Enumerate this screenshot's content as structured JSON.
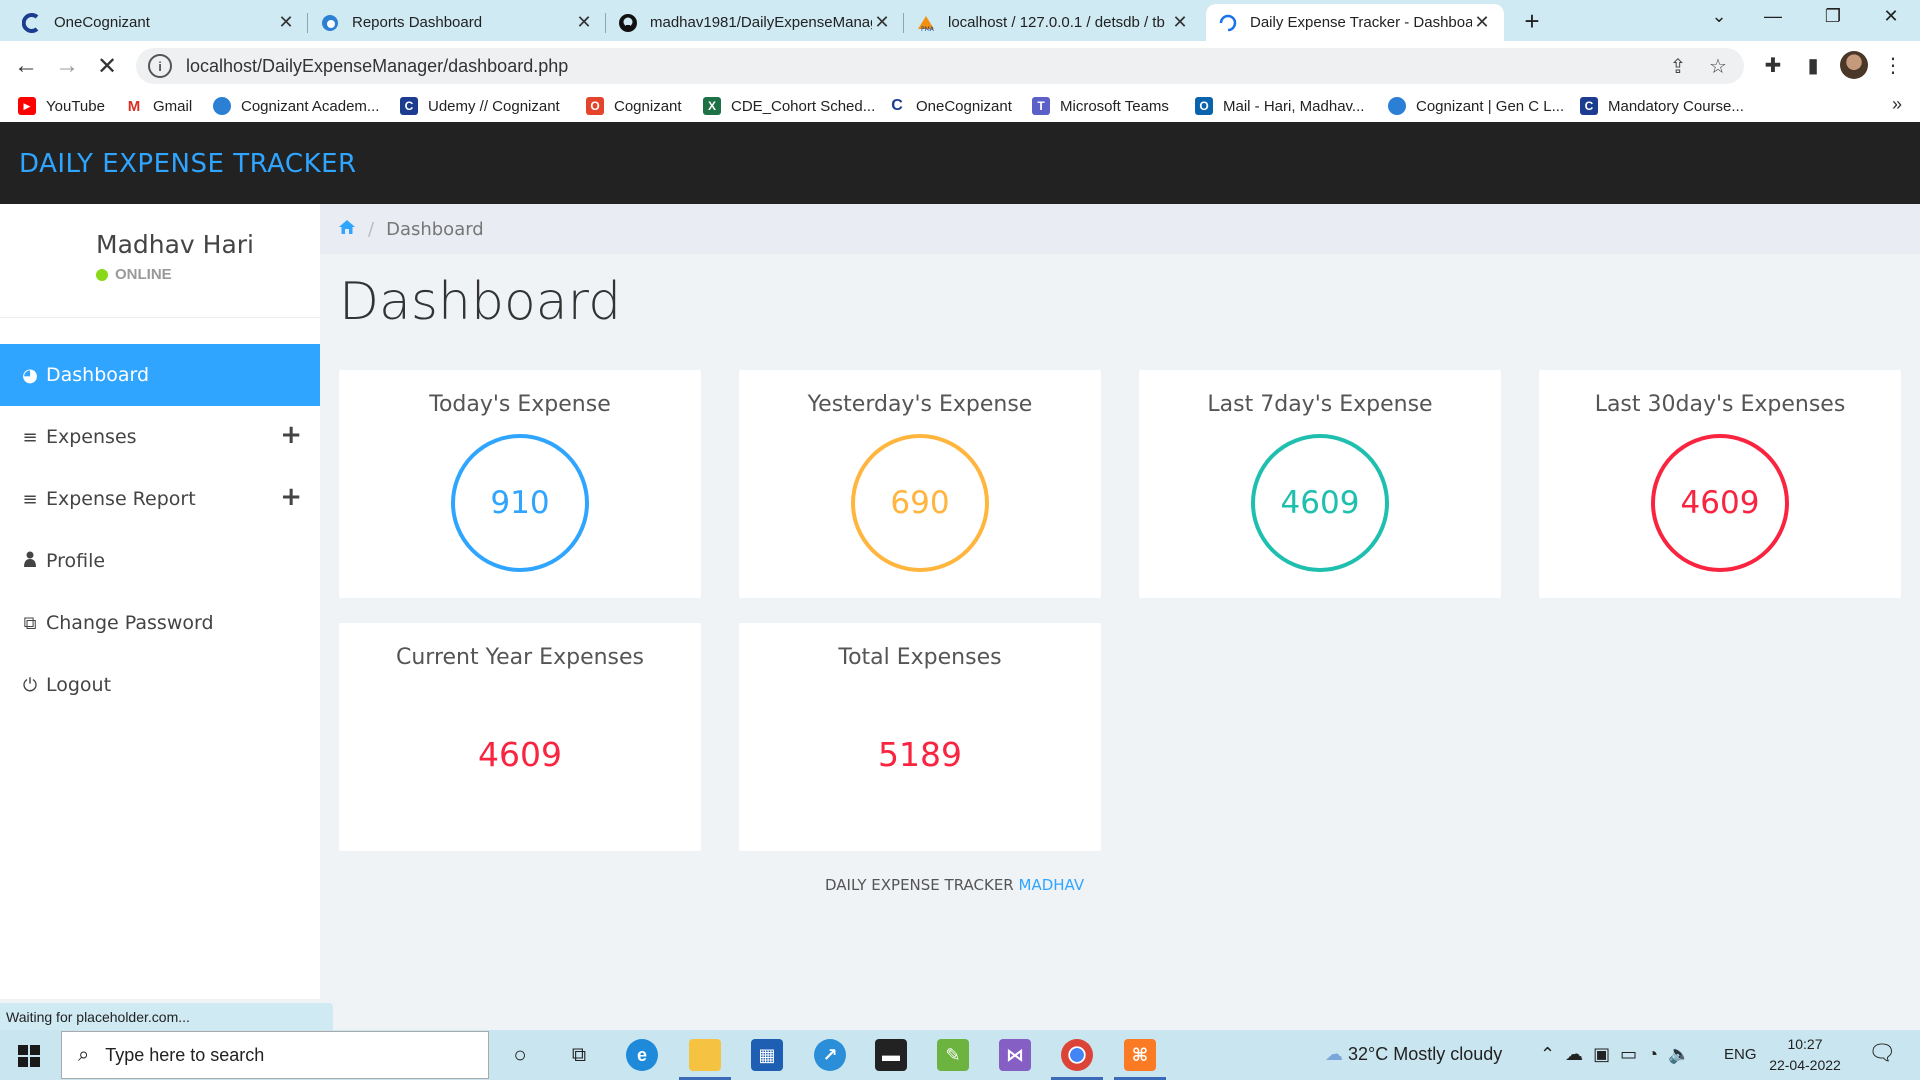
{
  "browser": {
    "tabs": [
      {
        "title": "OneCognizant"
      },
      {
        "title": "Reports Dashboard"
      },
      {
        "title": "madhav1981/DailyExpenseManag"
      },
      {
        "title": "localhost / 127.0.0.1 / detsdb / tb"
      },
      {
        "title": "Daily Expense Tracker - Dashboar"
      }
    ],
    "url": "localhost/DailyExpenseManager/dashboard.php",
    "bookmarks": [
      {
        "label": "YouTube"
      },
      {
        "label": "Gmail"
      },
      {
        "label": "Cognizant Academ..."
      },
      {
        "label": "Udemy // Cognizant"
      },
      {
        "label": "Cognizant"
      },
      {
        "label": "CDE_Cohort Sched..."
      },
      {
        "label": "OneCognizant"
      },
      {
        "label": "Microsoft Teams"
      },
      {
        "label": "Mail - Hari, Madhav..."
      },
      {
        "label": "Cognizant | Gen C L..."
      },
      {
        "label": "Mandatory Course..."
      }
    ],
    "status_text": "Waiting for placeholder.com..."
  },
  "app": {
    "brand": "DAILY EXPENSE TRACKER",
    "user": {
      "name": "Madhav Hari",
      "status": "ONLINE"
    },
    "nav": [
      {
        "label": "Dashboard",
        "active": true
      },
      {
        "label": "Expenses",
        "expandable": true
      },
      {
        "label": "Expense Report",
        "expandable": true
      },
      {
        "label": "Profile"
      },
      {
        "label": "Change Password"
      },
      {
        "label": "Logout"
      }
    ],
    "breadcrumb": {
      "current": "Dashboard"
    },
    "page_title": "Dashboard",
    "cards": [
      {
        "title": "Today's Expense",
        "value": "910",
        "color": "#30a5ff"
      },
      {
        "title": "Yesterday's Expense",
        "value": "690",
        "color": "#ffb53e"
      },
      {
        "title": "Last 7day's Expense",
        "value": "4609",
        "color": "#1ebfae"
      },
      {
        "title": "Last 30day's Expenses",
        "value": "4609",
        "color": "#f9243f"
      },
      {
        "title": "Current Year Expenses",
        "value": "4609",
        "color": "#f9243f"
      },
      {
        "title": "Total Expenses",
        "value": "5189",
        "color": "#f9243f"
      }
    ],
    "footer": {
      "text": "DAILY EXPENSE TRACKER",
      "link": "MADHAV"
    }
  },
  "taskbar": {
    "search_placeholder": "Type here to search",
    "weather": "32°C  Mostly cloudy",
    "lang": "ENG",
    "time": "10:27",
    "date": "22-04-2022"
  },
  "colors": {
    "accent": "#30a5ff",
    "header": "#222222"
  }
}
